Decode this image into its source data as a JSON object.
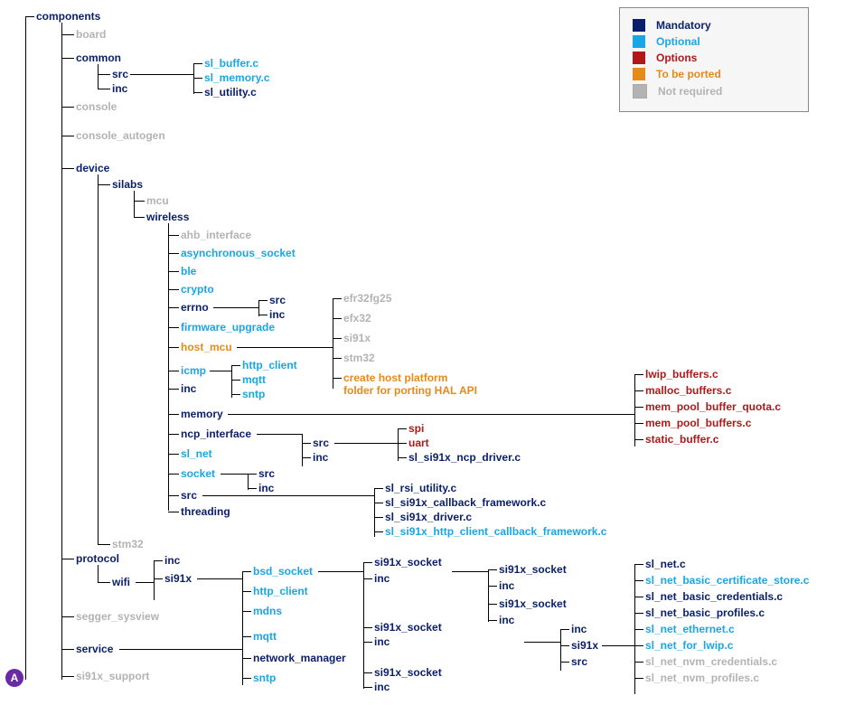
{
  "legend": {
    "mandatory": "Mandatory",
    "optional": "Optional",
    "options": "Options",
    "to_be_ported": "To be ported",
    "not_required": "Not required"
  },
  "colors": {
    "mandatory": "#0a1f6b",
    "optional": "#19a6e6",
    "options": "#b01919",
    "to_be_ported": "#e68a19",
    "not_required": "#b3b3b3"
  },
  "badge": "A",
  "tree": {
    "root": "components",
    "board": "board",
    "common": {
      "label": "common",
      "children": {
        "src": "src",
        "inc": "inc"
      },
      "files": {
        "f0": "sl_buffer.c",
        "f1": "sl_memory.c",
        "f2": "sl_utility.c"
      }
    },
    "console": "console",
    "console_autogen": "console_autogen",
    "device": {
      "label": "device",
      "silabs": {
        "label": "silabs",
        "mcu": "mcu",
        "wireless": {
          "label": "wireless",
          "ahb_interface": "ahb_interface",
          "asynchronous_socket": "asynchronous_socket",
          "ble": "ble",
          "crypto": "crypto",
          "errno": {
            "label": "errno",
            "src": "src",
            "inc": "inc"
          },
          "firmware_upgrade": "firmware_upgrade",
          "host_mcu": {
            "label": "host_mcu",
            "targets": {
              "t0": "efr32fg25",
              "t1": "efx32",
              "t2": "si91x",
              "t3": "stm32"
            },
            "note0": "create host platform",
            "note1": "folder for porting HAL API"
          },
          "icmp": {
            "label": "icmp",
            "clients": {
              "c0": "http_client",
              "c1": "mqtt",
              "c2": "sntp"
            }
          },
          "inc": "inc",
          "memory": {
            "label": "memory",
            "files": {
              "m0": "lwip_buffers.c",
              "m1": "malloc_buffers.c",
              "m2": "mem_pool_buffer_quota.c",
              "m3": "mem_pool_buffers.c",
              "m4": "static_buffer.c"
            }
          },
          "ncp_interface": {
            "label": "ncp_interface",
            "src": "src",
            "inc": "inc",
            "spi": "spi",
            "uart": "uart",
            "drv": "sl_si91x_ncp_driver.c"
          },
          "sl_net": "sl_net",
          "socket": {
            "label": "socket",
            "src": "src",
            "inc": "inc"
          },
          "src": "src",
          "threading": "threading",
          "src_files": {
            "s0": "sl_rsi_utility.c",
            "s1": "sl_si91x_callback_framework.c",
            "s2": "sl_si91x_driver.c",
            "s3": "sl_si91x_http_client_callback_framework.c"
          }
        }
      },
      "stm32": "stm32"
    },
    "protocol": {
      "label": "protocol",
      "wifi": "wifi",
      "inc": "inc",
      "si91x": {
        "label": "si91x",
        "bsd_socket": "bsd_socket",
        "http_client": "http_client",
        "mdns": "mdns",
        "mqtt": "mqtt",
        "network_manager": "network_manager",
        "sntp": "sntp",
        "col1": {
          "a": "si91x_socket",
          "b": "inc"
        },
        "col2": {
          "a": "si91x_socket",
          "b": "inc"
        },
        "col3": {
          "a": "inc",
          "b": "si91x",
          "c": "src"
        }
      }
    },
    "segger_sysview": "segger_sysview",
    "service": "service",
    "si91x_support": "si91x_support",
    "sl_net_files": {
      "n0": "sl_net.c",
      "n1": "sl_net_basic_certificate_store.c",
      "n2": "sl_net_basic_credentials.c",
      "n3": "sl_net_basic_profiles.c",
      "n4": "sl_net_ethernet.c",
      "n5": "sl_net_for_lwip.c",
      "n6": "sl_net_nvm_credentials.c",
      "n7": "sl_net_nvm_profiles.c"
    }
  }
}
